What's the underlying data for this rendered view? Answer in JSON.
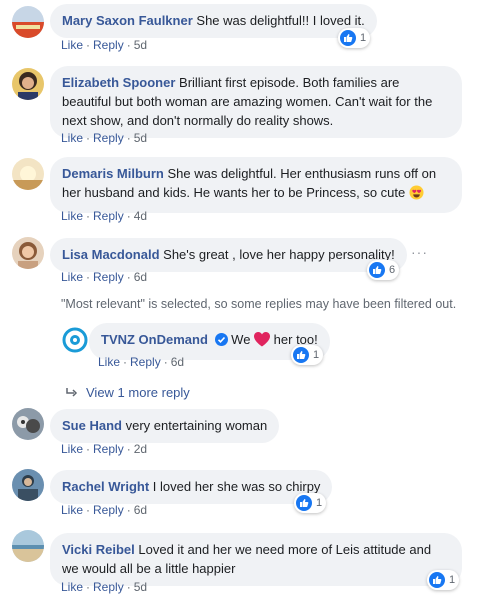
{
  "comments": [
    {
      "name": "Mary Saxon Faulkner",
      "text": "She was delightful!! I loved it.",
      "time": "5d",
      "likes": "1"
    },
    {
      "name": "Elizabeth Spooner",
      "text": "Brilliant first episode. Both families are beautiful but both woman are amazing women. Can't wait for the next show, and don't normally do reality shows.",
      "time": "5d"
    },
    {
      "name": "Demaris Milburn",
      "text": "She was delightful. Her enthusiasm runs off on her husband and kids. He wants her to be Princess, so cute",
      "time": "4d"
    },
    {
      "name": "Lisa Macdonald",
      "text": "She's great , love her happy personality!",
      "time": "6d",
      "likes": "6"
    },
    {
      "name": "Sue Hand",
      "text": "very entertaining woman",
      "time": "2d"
    },
    {
      "name": "Rachel Wright",
      "text": "I loved her she was so chirpy",
      "time": "6d",
      "likes": "1"
    },
    {
      "name": "Vicki Reibel",
      "text": "Loved it and her we need more of Leis attitude and we would all be a little happier",
      "time": "5d",
      "likes": "1"
    }
  ],
  "reply": {
    "name": "TVNZ OnDemand",
    "text_before": "We",
    "text_after": "her too!",
    "time": "6d",
    "likes": "1"
  },
  "notice": "\"Most relevant\" is selected, so some replies may have been filtered out.",
  "view_more": "View 1 more reply",
  "labels": {
    "like": "Like",
    "reply": "Reply",
    "dot": "·",
    "dots": "···"
  },
  "colors": {
    "link": "#385898",
    "like_blue": "#1877f2",
    "bubble": "#f0f2f5",
    "heart": "#e0245e"
  },
  "icons": {
    "like": "thumbs-up-icon",
    "heart": "red-heart-emoji",
    "heart_eyes": "heart-eyes-emoji",
    "reply_arrow": "reply-arrow-icon",
    "verified": "verified-badge-icon"
  }
}
